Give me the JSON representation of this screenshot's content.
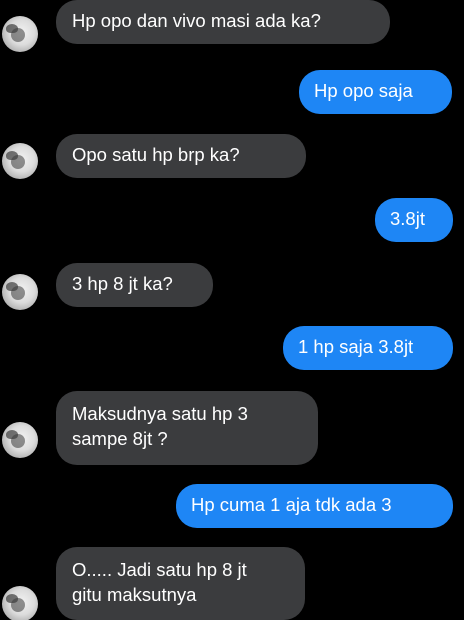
{
  "colors": {
    "background": "#000000",
    "incoming_bubble": "#3b3c3e",
    "outgoing_bubble": "#1e86f5",
    "text": "#ffffff"
  },
  "messages": [
    {
      "direction": "incoming",
      "lines": [
        "Hp opo dan vivo masi ada ka?"
      ]
    },
    {
      "direction": "outgoing",
      "lines": [
        "Hp opo saja"
      ]
    },
    {
      "direction": "incoming",
      "lines": [
        "Opo satu hp brp ka?"
      ]
    },
    {
      "direction": "outgoing",
      "lines": [
        "3.8jt"
      ]
    },
    {
      "direction": "incoming",
      "lines": [
        "3 hp 8 jt ka?"
      ]
    },
    {
      "direction": "outgoing",
      "lines": [
        "1 hp saja 3.8jt"
      ]
    },
    {
      "direction": "incoming",
      "lines": [
        "Maksudnya satu hp  3",
        "sampe 8jt ?"
      ]
    },
    {
      "direction": "outgoing",
      "lines": [
        "Hp cuma 1 aja tdk ada 3"
      ]
    },
    {
      "direction": "incoming",
      "lines": [
        "O..... Jadi satu hp 8 jt",
        "gitu maksutnya"
      ]
    }
  ]
}
